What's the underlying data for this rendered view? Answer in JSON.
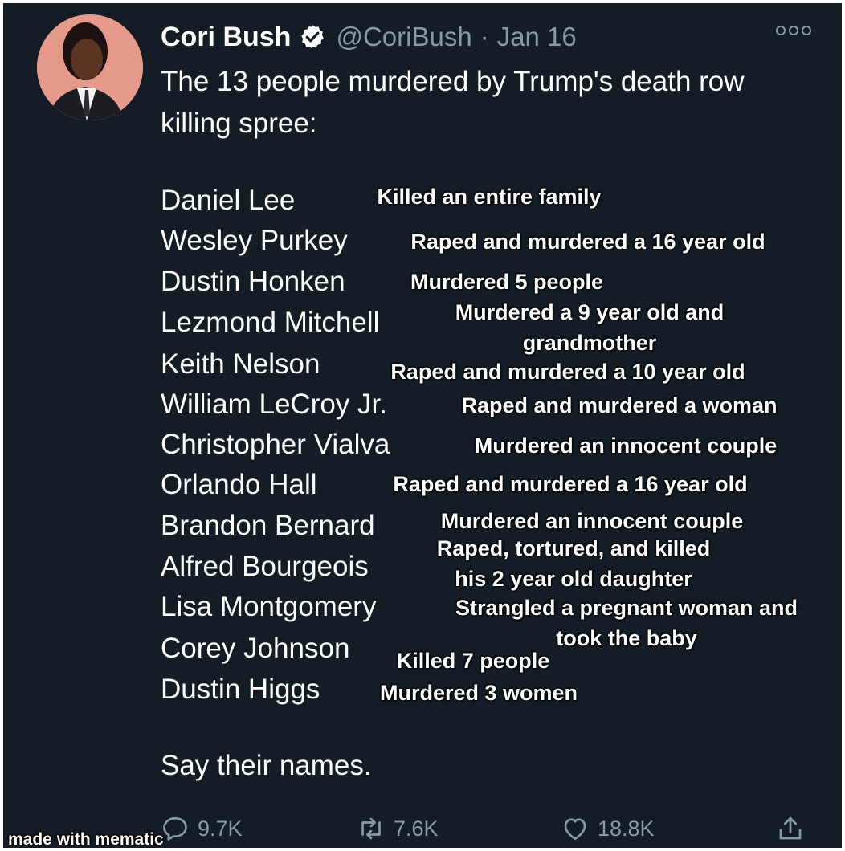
{
  "author": {
    "name": "Cori Bush",
    "handle": "@CoriBush",
    "separator": "·",
    "date": "Jan 16",
    "verified": true,
    "avatar_bg": "#e69a8a"
  },
  "more_icon": "more-options-icon",
  "text": {
    "intro": "The 13 people murdered by Trump's death row killing spree:",
    "outro": "Say their names."
  },
  "names": [
    "Daniel Lee",
    "Wesley Purkey",
    "Dustin Honken",
    "Lezmond Mitchell",
    "Keith Nelson",
    "William LeCroy Jr.",
    "Christopher Vialva",
    "Orlando Hall",
    "Brandon Bernard",
    "Alfred Bourgeois",
    "Lisa Montgomery",
    "Corey Johnson",
    "Dustin Higgs"
  ],
  "crimes": [
    [
      "Killed an entire family"
    ],
    [
      "Raped and murdered a 16 year old"
    ],
    [
      "Murdered 5 people"
    ],
    [
      "Murdered a 9 year old and",
      "grandmother"
    ],
    [
      "Raped and murdered a 10 year old"
    ],
    [
      "Raped and murdered a woman"
    ],
    [
      "Murdered an innocent couple"
    ],
    [
      "Raped and murdered a 16 year old"
    ],
    [
      "Murdered an innocent couple"
    ],
    [
      "Raped, tortured, and killed",
      "his 2 year old daughter"
    ],
    [
      "Strangled a pregnant woman and",
      "took the baby"
    ],
    [
      "Killed 7 people"
    ],
    [
      "Murdered 3 women"
    ]
  ],
  "actions": {
    "replies": {
      "icon": "reply-icon",
      "count": "9.7K"
    },
    "retweets": {
      "icon": "retweet-icon",
      "count": "7.6K"
    },
    "likes": {
      "icon": "heart-icon",
      "count": "18.8K"
    },
    "share": {
      "icon": "share-icon"
    }
  },
  "watermark": "made with mematic",
  "colors": {
    "background": "#141d26",
    "text": "#ffffff",
    "secondary": "#8899a6",
    "verified_badge": "#ffffff"
  }
}
